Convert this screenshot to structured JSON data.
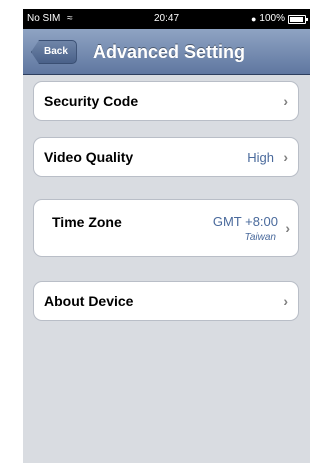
{
  "status_bar": {
    "carrier": "No SIM",
    "time": "20:47",
    "battery": "100%"
  },
  "nav": {
    "back_label": "Back",
    "title": "Advanced Setting"
  },
  "rows": {
    "security_code": {
      "label": "Security Code",
      "chevron": "›"
    },
    "video_quality": {
      "label": "Video Quality",
      "value": "High",
      "chevron": "›"
    },
    "time_zone": {
      "label": "Time Zone",
      "value": "GMT +8:00",
      "subvalue": "Taiwan",
      "chevron": "›"
    },
    "about_device": {
      "label": "About Device",
      "chevron": "›"
    }
  }
}
